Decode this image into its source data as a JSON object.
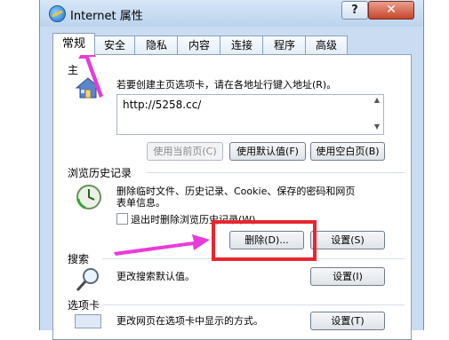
{
  "window": {
    "title": "Internet 属性",
    "help_label": "?",
    "close_label": "✕"
  },
  "tabs": [
    {
      "label": "常规",
      "active": true
    },
    {
      "label": "安全"
    },
    {
      "label": "隐私"
    },
    {
      "label": "内容"
    },
    {
      "label": "连接"
    },
    {
      "label": "程序"
    },
    {
      "label": "高级"
    }
  ],
  "homepage": {
    "section_label": "主",
    "description": "若要创建主页选项卡，请在各地址行键入地址(R)。",
    "url": "http://5258.cc/",
    "btn_current": "使用当前页(C)",
    "btn_default": "使用默认值(F)",
    "btn_blank": "使用空白页(B)"
  },
  "history": {
    "section_label": "浏览历史记录",
    "description_line1": "删除临时文件、历史记录、Cookie、保存的密码和网页",
    "description_line2": "表单信息。",
    "checkbox_label": "退出时删除浏览历史记录(W)",
    "btn_delete": "删除(D)...",
    "btn_settings": "设置(S)"
  },
  "search": {
    "section_label": "搜索",
    "description": "更改搜索默认值。",
    "btn_settings": "设置(I)"
  },
  "tabs_section": {
    "section_label": "选项卡",
    "description": "更改网页在选项卡中显示的方式。",
    "btn_settings": "设置(T)"
  },
  "colors": {
    "highlight": "#e8262e",
    "arrow": "#e83bd8"
  },
  "icons": [
    "ie-logo-icon",
    "home-icon",
    "history-clock-icon",
    "search-magnifier-icon",
    "tab-icon"
  ]
}
